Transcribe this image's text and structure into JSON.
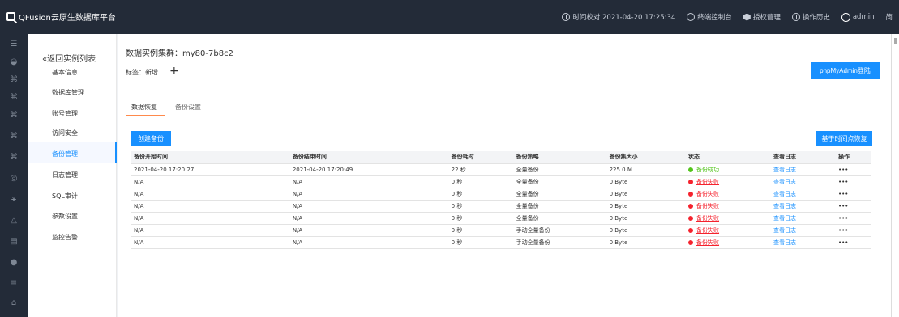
{
  "app": {
    "title": "QFusion云原生数据库平台"
  },
  "topnav": {
    "time_sync": "时间校对 2021-04-20 17:25:34",
    "terminal": "终端控制台",
    "license": "授权管理",
    "history": "操作历史",
    "user": "admin",
    "lang": "简"
  },
  "sidebar": {
    "back": "«返回实例列表",
    "items": [
      {
        "label": "基本信息"
      },
      {
        "label": "数据库管理"
      },
      {
        "label": "账号管理"
      },
      {
        "label": "访问安全"
      },
      {
        "label": "备份管理"
      },
      {
        "label": "日志管理"
      },
      {
        "label": "SQL审计"
      },
      {
        "label": "参数设置"
      },
      {
        "label": "监控告警"
      }
    ]
  },
  "header": {
    "cluster": "数据实例集群：my80-7b8c2",
    "tag_label": "标签：",
    "tag_new": "新增",
    "tag_add": "+",
    "phpmyadmin": "phpMyAdmin登陆"
  },
  "tabs": [
    {
      "label": "数据恢复"
    },
    {
      "label": "备份设置"
    }
  ],
  "actions": {
    "create": "创建备份",
    "restore_time": "基于时间点恢复"
  },
  "table": {
    "headers": [
      "备份开始时间",
      "备份结束时间",
      "备份耗时",
      "备份策略",
      "备份集大小",
      "状态",
      "查看日志",
      "操作"
    ],
    "rows": [
      [
        "2021-04-20 17:20:27",
        "2021-04-20 17:20:49",
        "22 秒",
        "全量备份",
        "225.0 M",
        "备份成功",
        "查看日志",
        "•••"
      ],
      [
        "N/A",
        "N/A",
        "0 秒",
        "全量备份",
        "0 Byte",
        "备份失败",
        "查看日志",
        "•••"
      ],
      [
        "N/A",
        "N/A",
        "0 秒",
        "全量备份",
        "0 Byte",
        "备份失败",
        "查看日志",
        "•••"
      ],
      [
        "N/A",
        "N/A",
        "0 秒",
        "全量备份",
        "0 Byte",
        "备份失败",
        "查看日志",
        "•••"
      ],
      [
        "N/A",
        "N/A",
        "0 秒",
        "全量备份",
        "0 Byte",
        "备份失败",
        "查看日志",
        "•••"
      ],
      [
        "N/A",
        "N/A",
        "0 秒",
        "手动全量备份",
        "0 Byte",
        "备份失败",
        "查看日志",
        "•••"
      ],
      [
        "N/A",
        "N/A",
        "0 秒",
        "手动全量备份",
        "0 Byte",
        "备份失败",
        "查看日志",
        "•••"
      ]
    ]
  },
  "rail_icons": [
    "menu-icon",
    "database-icon",
    "cluster-icon",
    "cluster-icon",
    "cluster-icon",
    "cluster-icon",
    "cluster-icon",
    "target-icon",
    "network-icon",
    "alarm-icon",
    "document-icon",
    "settings-icon",
    "list-icon",
    "home-icon"
  ]
}
